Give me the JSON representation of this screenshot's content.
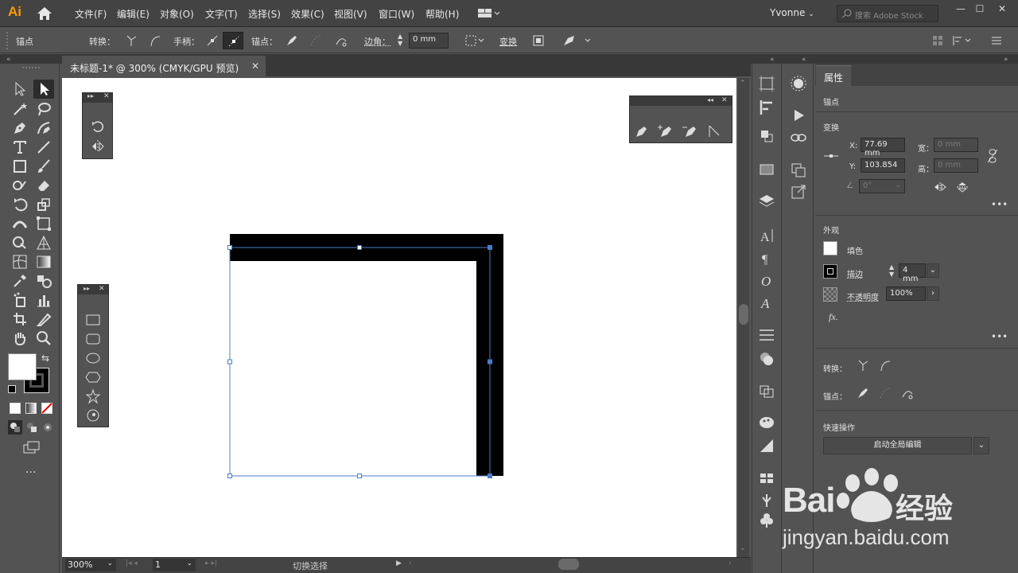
{
  "app": {
    "logo": "Ai"
  },
  "menu": [
    "文件(F)",
    "编辑(E)",
    "对象(O)",
    "文字(T)",
    "选择(S)",
    "效果(C)",
    "视图(V)",
    "窗口(W)",
    "帮助(H)"
  ],
  "user": "Yvonne",
  "search": {
    "placeholder": "搜索 Adobe Stock"
  },
  "control_bar": {
    "selection_label": "锚点",
    "convert_label": "转换：",
    "handles_label": "手柄：",
    "anchors_label": "锚点：",
    "corners_label": "边角：",
    "corner_value": "0 mm",
    "transform_label": "变换"
  },
  "document": {
    "tab_title": "未标题-1* @ 300% (CMYK/GPU 预览)",
    "zoom": "300%",
    "page": "1",
    "status": "切换选择"
  },
  "properties": {
    "tab": "属性",
    "selection_type": "锚点",
    "transform_section": "变换",
    "x_label": "X:",
    "x_value": "77.69 mm",
    "y_label": "Y:",
    "y_value": "103.854",
    "width_label": "宽：",
    "width_value": "0 mm",
    "height_label": "高：",
    "height_value": "0 mm",
    "angle_value": "0°",
    "appearance_section": "外观",
    "fill_label": "填色",
    "stroke_label": "描边",
    "stroke_value": "4 mm",
    "opacity_label": "不透明度",
    "opacity_value": "100%",
    "fx_label": "fx.",
    "convert_label": "转换：",
    "anchor_label": "锚点：",
    "quick_actions_section": "快速操作",
    "global_edit_button": "启动全局编辑"
  },
  "watermark": {
    "brand": "Bai",
    "brand2": "经验",
    "url": "jingyan.baidu.com"
  },
  "colors": {
    "accent": "#ff9a00",
    "selection": "#4a7cc7",
    "panel": "#535353"
  }
}
